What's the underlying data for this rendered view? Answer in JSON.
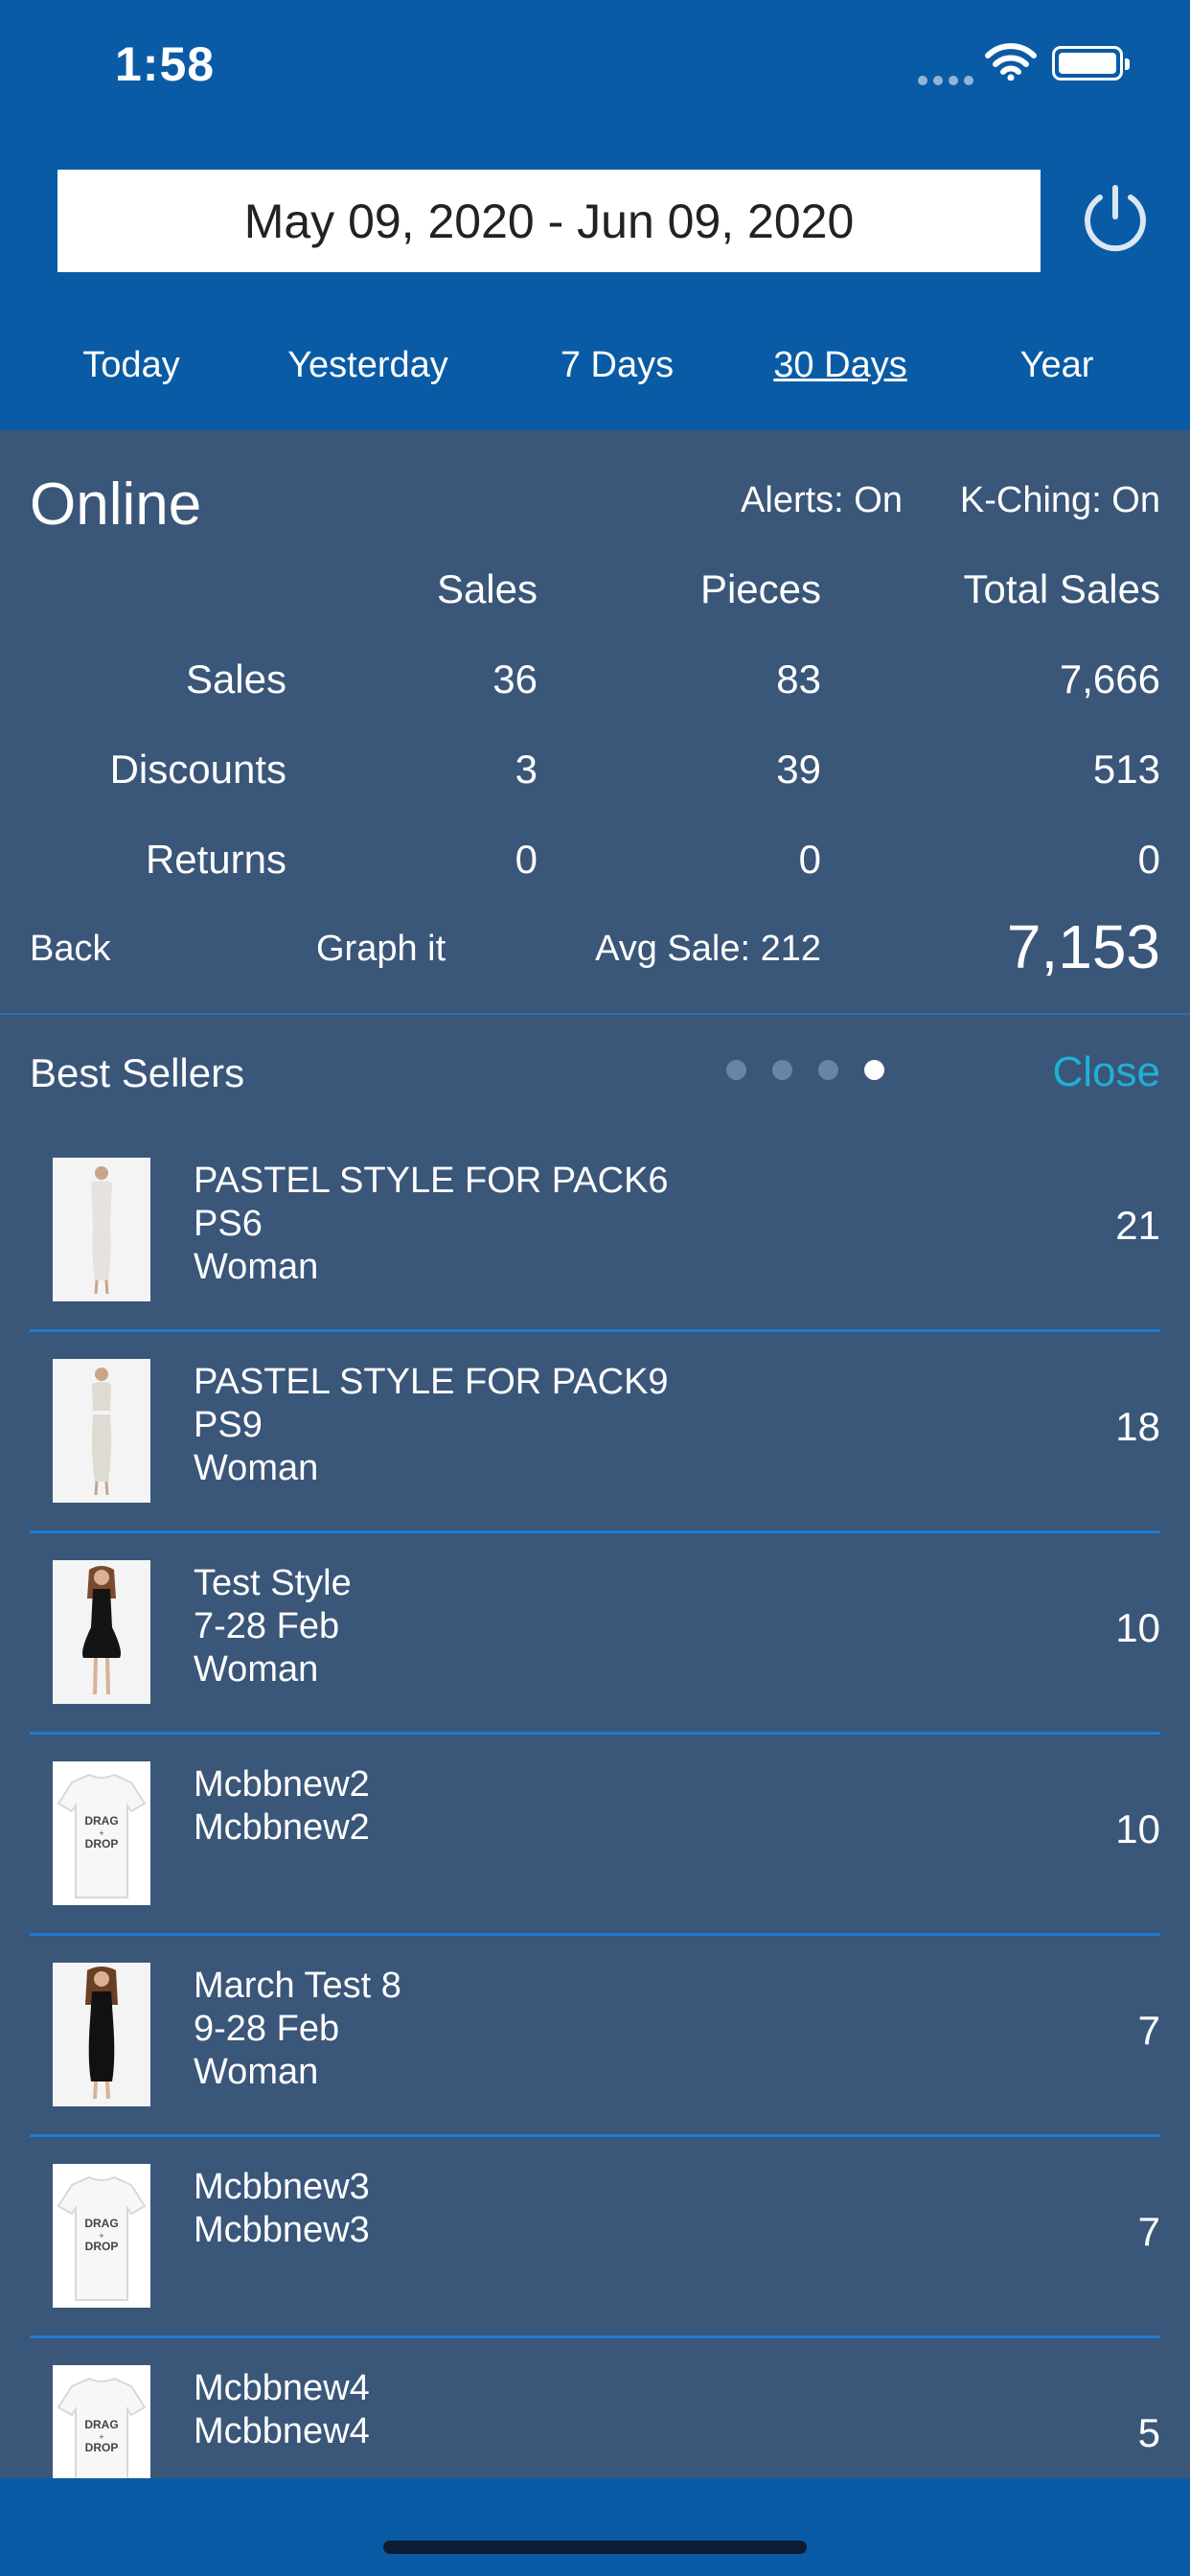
{
  "status_bar": {
    "time": "1:58"
  },
  "date_range": {
    "text": "May 09, 2020  -  Jun 09, 2020"
  },
  "range_tabs": [
    {
      "label": "Today",
      "active": false
    },
    {
      "label": "Yesterday",
      "active": false
    },
    {
      "label": "7 Days",
      "active": false
    },
    {
      "label": "30 Days",
      "active": true
    },
    {
      "label": "Year",
      "active": false
    }
  ],
  "summary": {
    "channel": "Online",
    "alerts": "Alerts: On",
    "kching": "K-Ching: On",
    "columns": [
      "Sales",
      "Pieces",
      "Total Sales"
    ],
    "rows": [
      {
        "label": "Sales",
        "values": [
          "36",
          "83",
          "7,666"
        ]
      },
      {
        "label": "Discounts",
        "values": [
          "3",
          "39",
          "513"
        ]
      },
      {
        "label": "Returns",
        "values": [
          "0",
          "0",
          "0"
        ]
      }
    ],
    "back_label": "Back",
    "graph_label": "Graph it",
    "avg_sale": "Avg Sale: 212",
    "net_total": "7,153"
  },
  "best_sellers": {
    "title": "Best Sellers",
    "close_label": "Close",
    "page_count": 4,
    "active_page": 4,
    "items": [
      {
        "line1": "PASTEL STYLE FOR PACK6",
        "line2": "PS6",
        "line3": "Woman",
        "qty": "21",
        "image": "dress-white"
      },
      {
        "line1": "PASTEL STYLE FOR PACK9",
        "line2": "PS9",
        "line3": "Woman",
        "qty": "18",
        "image": "two-piece-white"
      },
      {
        "line1": "Test Style",
        "line2": "7-28 Feb",
        "line3": "Woman",
        "qty": "10",
        "image": "dress-black"
      },
      {
        "line1": "Mcbbnew2",
        "line2": "Mcbbnew2",
        "line3": "",
        "qty": "10",
        "image": "tshirt-drag-drop"
      },
      {
        "line1": "March Test 8",
        "line2": "9-28 Feb",
        "line3": "Woman",
        "qty": "7",
        "image": "dress-black"
      },
      {
        "line1": "Mcbbnew3",
        "line2": "Mcbbnew3",
        "line3": "",
        "qty": "7",
        "image": "tshirt-drag-drop"
      },
      {
        "line1": "Mcbbnew4",
        "line2": "Mcbbnew4",
        "line3": "",
        "qty": "5",
        "image": "tshirt-drag-drop"
      }
    ],
    "tshirt_print": [
      "DRAG",
      "+",
      "DROP"
    ]
  }
}
